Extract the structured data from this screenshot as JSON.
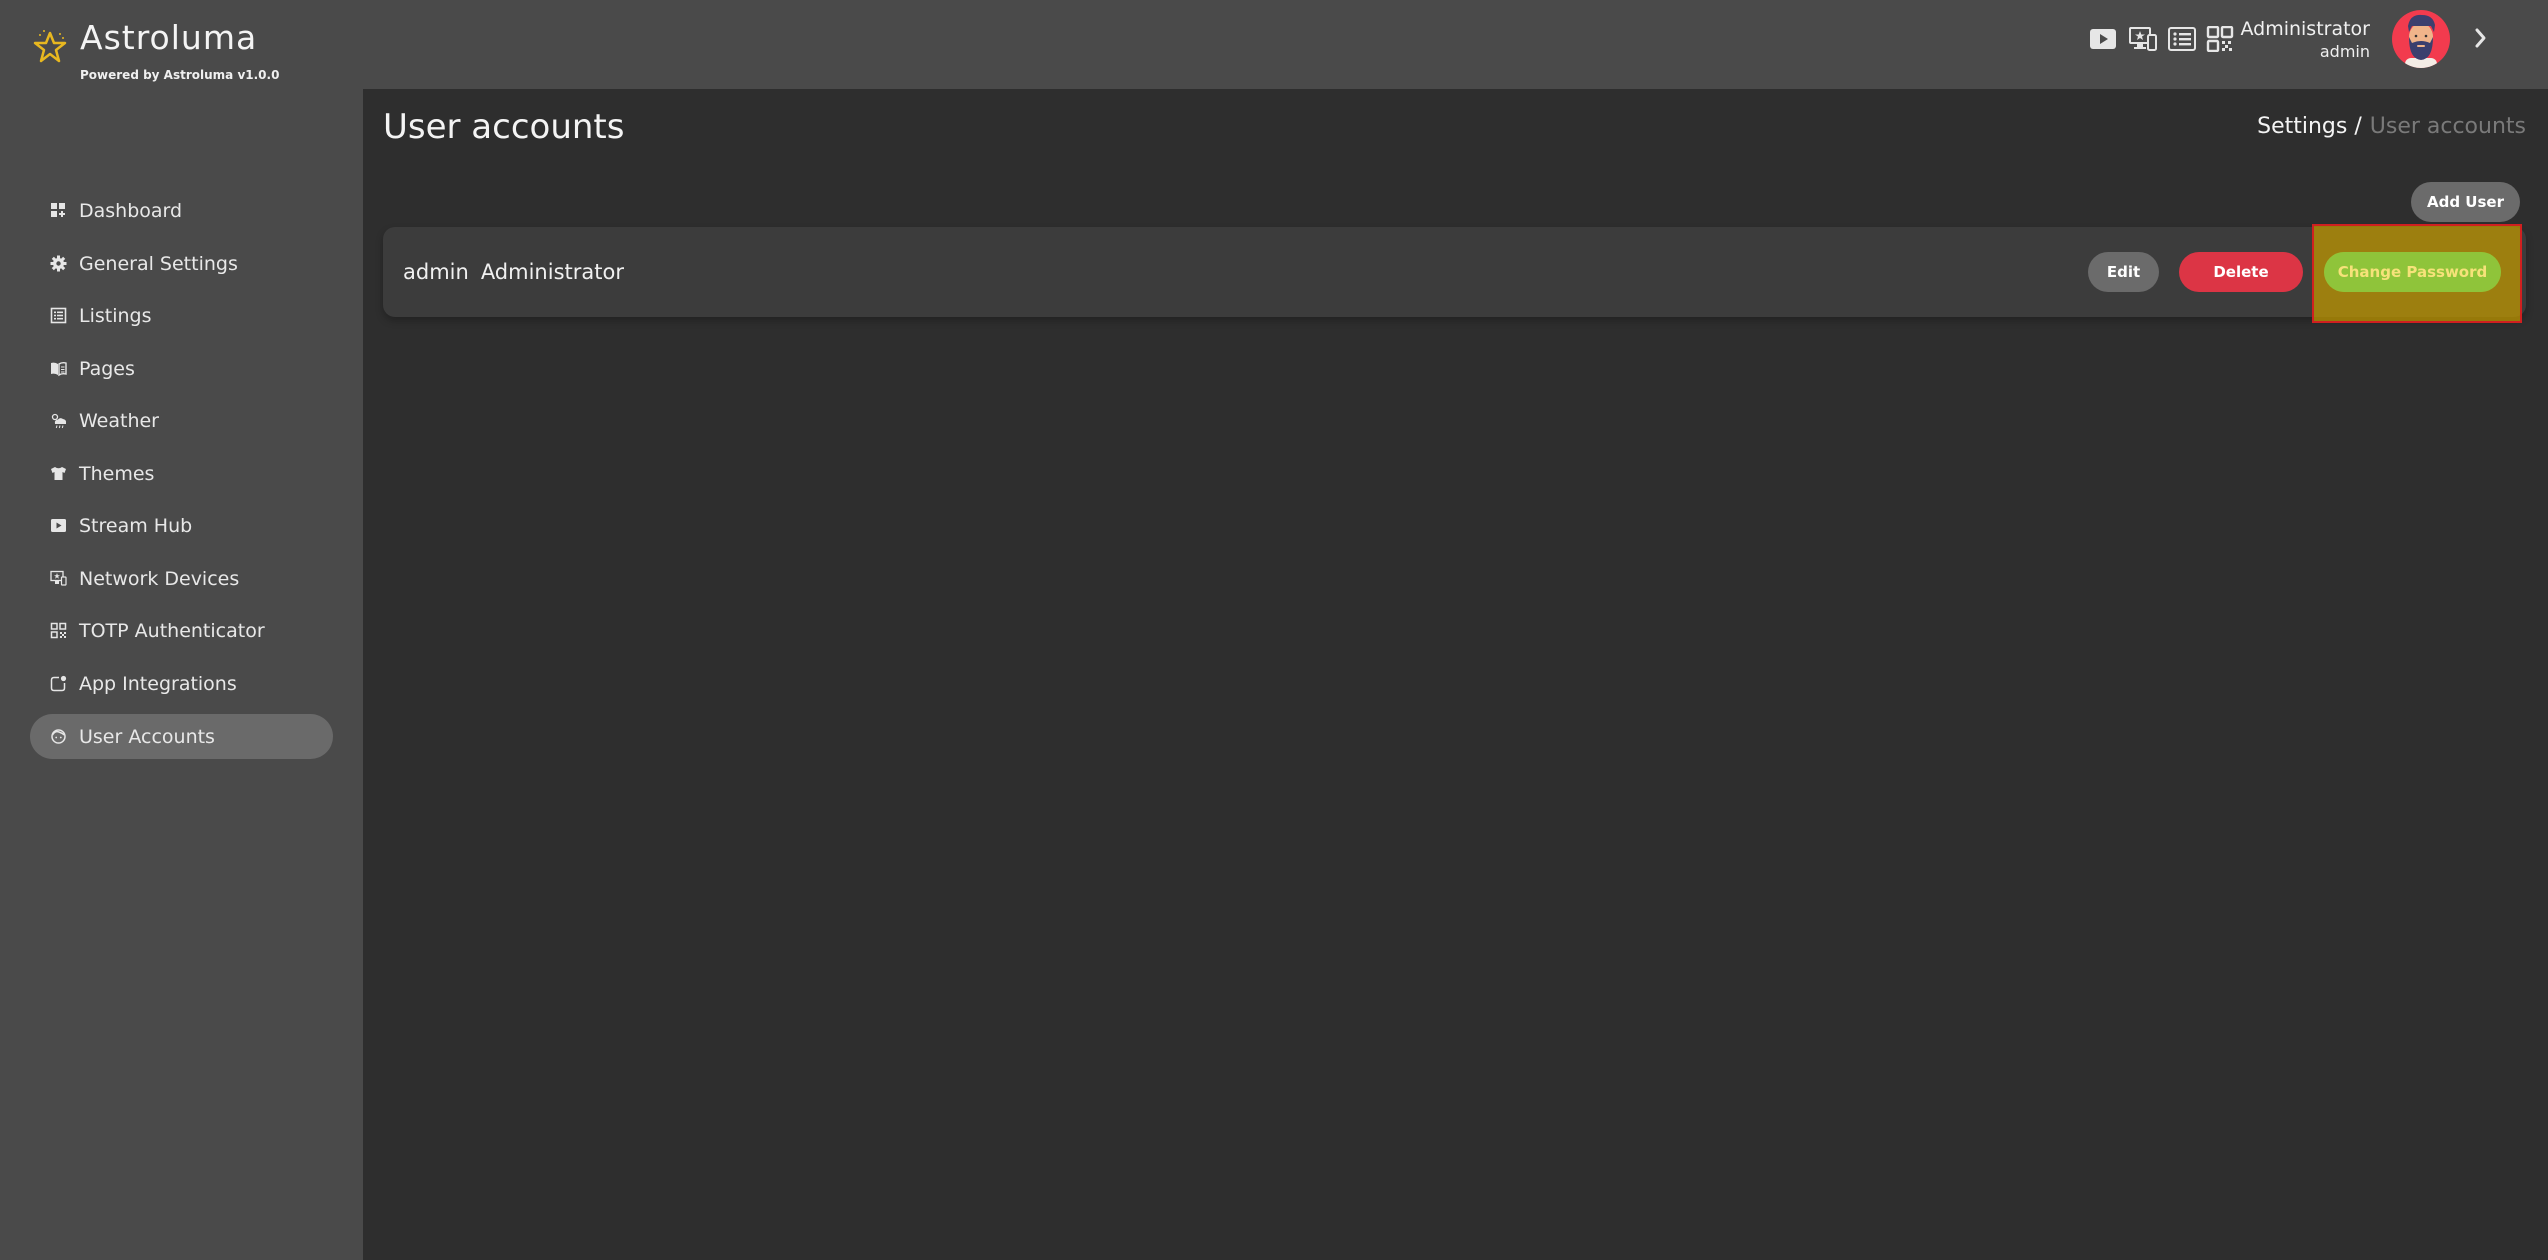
{
  "app": {
    "title": "Astroluma",
    "powered_by": "Powered by Astroluma v1.0.0",
    "logo_icon": "star-icon",
    "accent": "#e8b820"
  },
  "header": {
    "icons": [
      "play-icon",
      "device-icon",
      "list-icon",
      "qr-code-icon"
    ],
    "user": {
      "name": "Administrator",
      "role": "admin"
    },
    "expand_icon": "chevron-right-icon"
  },
  "sidebar": {
    "items": [
      {
        "label": "Dashboard",
        "icon": "dashboard-icon",
        "active": false
      },
      {
        "label": "General Settings",
        "icon": "gear-icon",
        "active": false
      },
      {
        "label": "Listings",
        "icon": "listings-icon",
        "active": false
      },
      {
        "label": "Pages",
        "icon": "book-icon",
        "active": false
      },
      {
        "label": "Weather",
        "icon": "weather-icon",
        "active": false
      },
      {
        "label": "Themes",
        "icon": "shirt-icon",
        "active": false
      },
      {
        "label": "Stream Hub",
        "icon": "play-icon",
        "active": false
      },
      {
        "label": "Network Devices",
        "icon": "device-icon",
        "active": false
      },
      {
        "label": "TOTP Authenticator",
        "icon": "qr-code-icon",
        "active": false
      },
      {
        "label": "App Integrations",
        "icon": "integration-icon",
        "active": false
      },
      {
        "label": "User Accounts",
        "icon": "user-face-icon",
        "active": true
      }
    ]
  },
  "main": {
    "title": "User accounts",
    "breadcrumb": {
      "parent": "Settings /",
      "current": "User accounts"
    },
    "add_user_label": "Add User",
    "users": [
      {
        "username": "admin",
        "display_name": "Administrator",
        "actions": {
          "edit": "Edit",
          "delete": "Delete",
          "change_password": "Change Password"
        }
      }
    ]
  },
  "colors": {
    "delete": "#dc3545",
    "change_password": "#8fc43a",
    "neutral_button": "#6b6b6b"
  }
}
